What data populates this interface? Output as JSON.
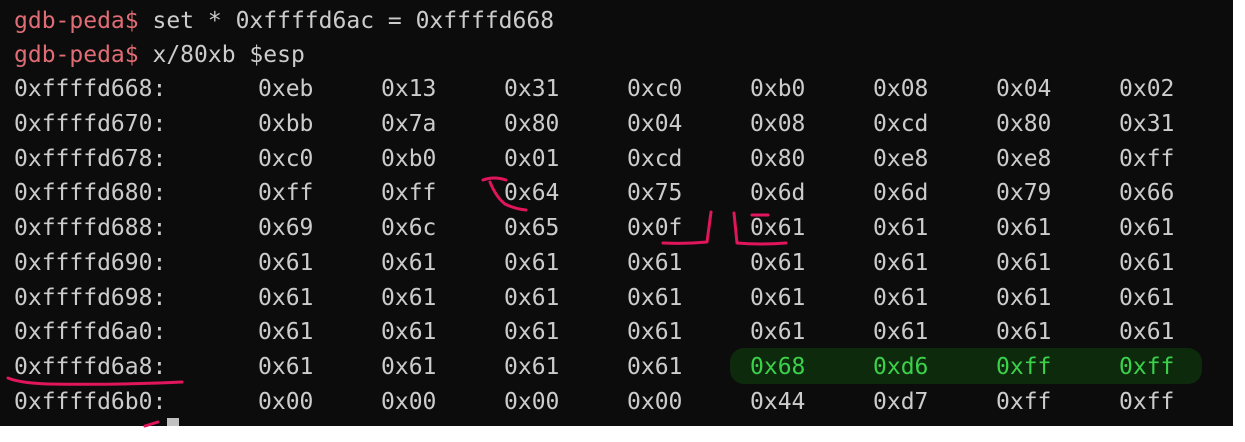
{
  "terminal": {
    "prompt": "gdb-peda$",
    "commands": [
      "set * 0xffffd6ac = 0xffffd668",
      "x/80xb $esp"
    ],
    "highlight_color": "#3bd14a",
    "prompt_color": "#e06c75",
    "rows": [
      {
        "addr": "0xffffd668:",
        "bytes": [
          "0xeb",
          "0x13",
          "0x31",
          "0xc0",
          "0xb0",
          "0x08",
          "0x04",
          "0x02"
        ]
      },
      {
        "addr": "0xffffd670:",
        "bytes": [
          "0xbb",
          "0x7a",
          "0x80",
          "0x04",
          "0x08",
          "0xcd",
          "0x80",
          "0x31"
        ]
      },
      {
        "addr": "0xffffd678:",
        "bytes": [
          "0xc0",
          "0xb0",
          "0x01",
          "0xcd",
          "0x80",
          "0xe8",
          "0xe8",
          "0xff"
        ]
      },
      {
        "addr": "0xffffd680:",
        "bytes": [
          "0xff",
          "0xff",
          "0x64",
          "0x75",
          "0x6d",
          "0x6d",
          "0x79",
          "0x66"
        ]
      },
      {
        "addr": "0xffffd688:",
        "bytes": [
          "0x69",
          "0x6c",
          "0x65",
          "0x0f",
          "0x61",
          "0x61",
          "0x61",
          "0x61"
        ]
      },
      {
        "addr": "0xffffd690:",
        "bytes": [
          "0x61",
          "0x61",
          "0x61",
          "0x61",
          "0x61",
          "0x61",
          "0x61",
          "0x61"
        ]
      },
      {
        "addr": "0xffffd698:",
        "bytes": [
          "0x61",
          "0x61",
          "0x61",
          "0x61",
          "0x61",
          "0x61",
          "0x61",
          "0x61"
        ]
      },
      {
        "addr": "0xffffd6a0:",
        "bytes": [
          "0x61",
          "0x61",
          "0x61",
          "0x61",
          "0x61",
          "0x61",
          "0x61",
          "0x61"
        ]
      },
      {
        "addr": "0xffffd6a8:",
        "bytes": [
          "0x61",
          "0x61",
          "0x61",
          "0x61",
          "0x68",
          "0xd6",
          "0xff",
          "0xff"
        ]
      },
      {
        "addr": "0xffffd6b0:",
        "bytes": [
          "0x00",
          "0x00",
          "0x00",
          "0x00",
          "0x44",
          "0xd7",
          "0xff",
          "0xff"
        ]
      }
    ],
    "highlighted_bytes": [
      {
        "row": 8,
        "col": 4
      },
      {
        "row": 8,
        "col": 5
      },
      {
        "row": 8,
        "col": 6
      },
      {
        "row": 8,
        "col": 7
      }
    ]
  }
}
